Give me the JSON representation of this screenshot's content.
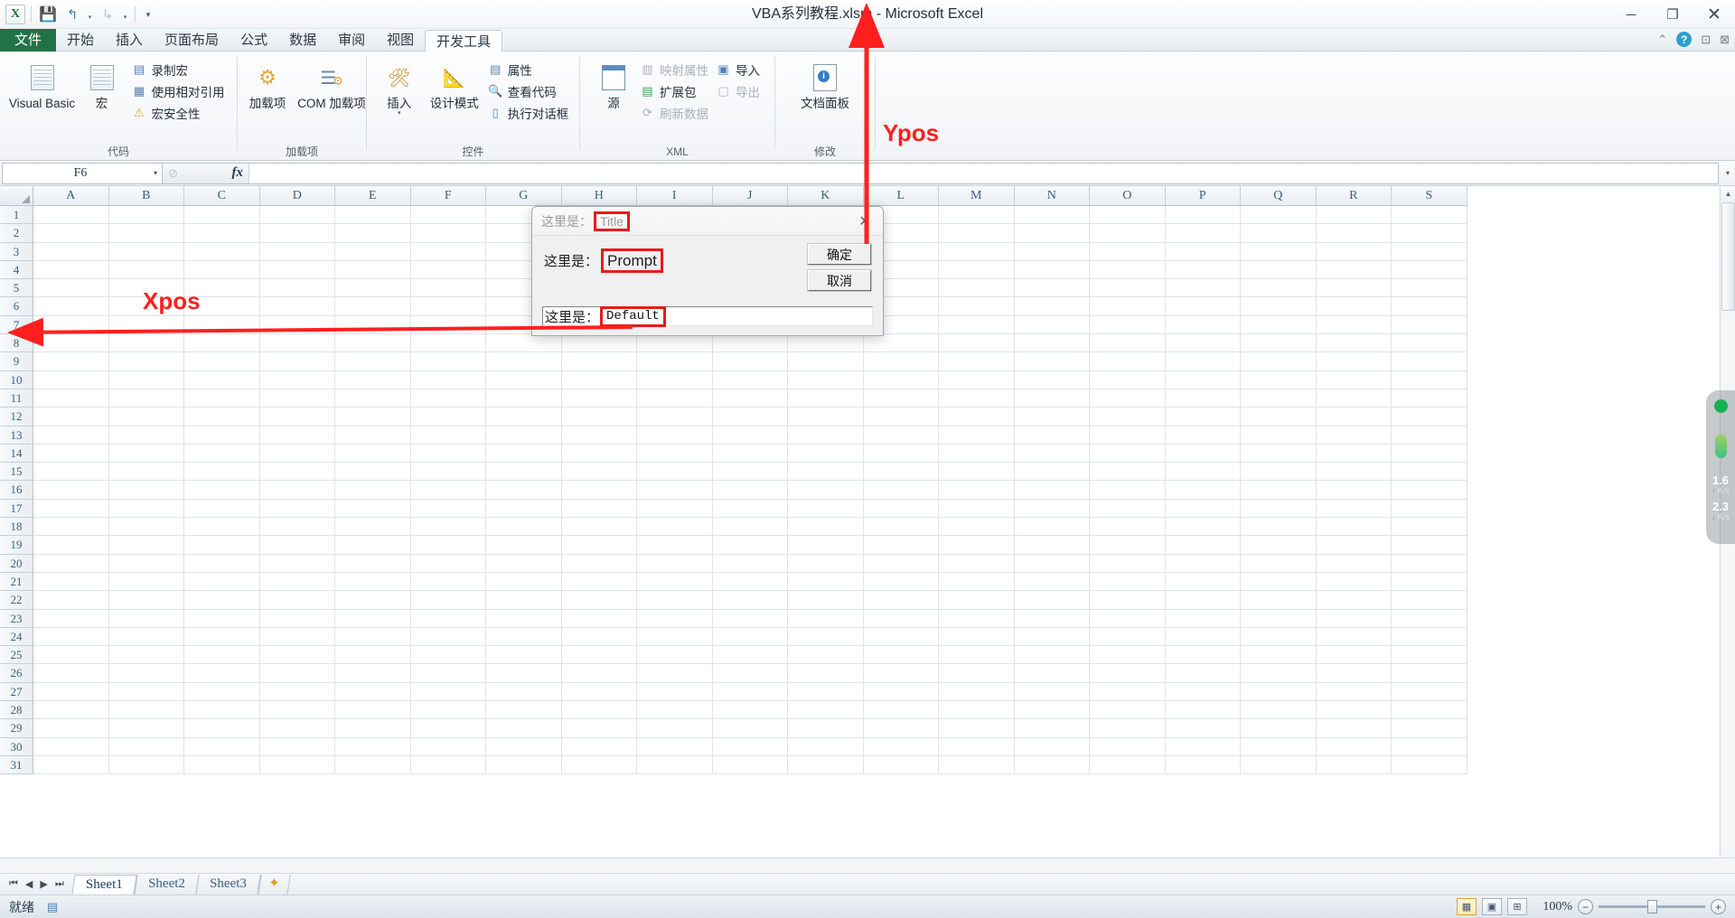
{
  "window": {
    "title": "VBA系列教程.xlsm - Microsoft Excel",
    "minimize": "─",
    "maximize": "❐",
    "close": "✕"
  },
  "quick_access": {
    "logo": "X",
    "save": "💾",
    "undo": "↰",
    "redo": "↳",
    "caret": "▾",
    "more": "▾"
  },
  "help_icons": {
    "collapse_ribbon": "⌃",
    "help": "?",
    "restore_window": "⊡",
    "close_window": "⊠"
  },
  "tabs": [
    {
      "label": "文件",
      "kind": "file"
    },
    {
      "label": "开始",
      "kind": "normal"
    },
    {
      "label": "插入",
      "kind": "normal"
    },
    {
      "label": "页面布局",
      "kind": "normal"
    },
    {
      "label": "公式",
      "kind": "normal"
    },
    {
      "label": "数据",
      "kind": "normal"
    },
    {
      "label": "审阅",
      "kind": "normal"
    },
    {
      "label": "视图",
      "kind": "normal"
    },
    {
      "label": "开发工具",
      "kind": "active"
    }
  ],
  "ribbon": {
    "groups": [
      {
        "label": "代码",
        "big": [
          {
            "label": "Visual Basic",
            "icon": "vba-icon"
          },
          {
            "label": "宏",
            "icon": "macro-icon"
          }
        ],
        "small": [
          {
            "label": "录制宏",
            "icon": "record-macro-icon",
            "dim": false
          },
          {
            "label": "使用相对引用",
            "icon": "relative-reference-icon",
            "dim": false
          },
          {
            "label": "宏安全性",
            "icon": "macro-security-icon",
            "dim": false
          }
        ]
      },
      {
        "label": "加载项",
        "big": [
          {
            "label": "加载项",
            "icon": "addins-icon"
          },
          {
            "label": "COM 加载项",
            "icon": "com-addins-icon"
          }
        ],
        "small": []
      },
      {
        "label": "控件",
        "big": [
          {
            "label": "插入",
            "icon": "insert-control-icon",
            "dropdown": "▾"
          },
          {
            "label": "设计模式",
            "icon": "design-mode-icon"
          }
        ],
        "small": [
          {
            "label": "属性",
            "icon": "properties-icon",
            "dim": false
          },
          {
            "label": "查看代码",
            "icon": "view-code-icon",
            "dim": false
          },
          {
            "label": "执行对话框",
            "icon": "run-dialog-icon",
            "dim": false
          }
        ]
      },
      {
        "label": "XML",
        "big": [
          {
            "label": "源",
            "icon": "xml-source-icon"
          }
        ],
        "small": [
          {
            "label": "映射属性",
            "icon": "map-properties-icon",
            "dim": true
          },
          {
            "label": "扩展包",
            "icon": "expansion-pack-icon",
            "dim": false
          },
          {
            "label": "刷新数据",
            "icon": "refresh-data-icon",
            "dim": true
          }
        ],
        "small2": [
          {
            "label": "导入",
            "icon": "import-icon",
            "dim": false
          },
          {
            "label": "导出",
            "icon": "export-icon",
            "dim": true
          }
        ]
      },
      {
        "label": "修改",
        "big": [
          {
            "label": "文档面板",
            "icon": "document-panel-icon"
          }
        ],
        "small": []
      }
    ]
  },
  "formula_bar": {
    "name_box": "F6",
    "name_box_caret": "▾",
    "cancel_icon": "⊘",
    "fx_symbol": "fx",
    "formula_value": "",
    "expand_caret": "▾"
  },
  "grid": {
    "columns": [
      "A",
      "B",
      "C",
      "D",
      "E",
      "F",
      "G",
      "H",
      "I",
      "J",
      "K",
      "L",
      "M",
      "N",
      "O",
      "P",
      "Q",
      "R",
      "S"
    ],
    "rows": [
      1,
      2,
      3,
      4,
      5,
      6,
      7,
      8,
      9,
      10,
      11,
      12,
      13,
      14,
      15,
      16,
      17,
      18,
      19,
      20,
      21,
      22,
      23,
      24,
      25,
      26,
      27,
      28,
      29,
      30,
      31
    ]
  },
  "dialog": {
    "title_prefix": "这里是：",
    "title_value": "Title",
    "close_icon": "✕",
    "prompt_prefix": "这里是：",
    "prompt_value": "Prompt",
    "ok_button": "确定",
    "cancel_button": "取消",
    "default_prefix": "这里是：",
    "default_value": "Default"
  },
  "annotations": {
    "xpos": "Xpos",
    "ypos": "Ypos",
    "arrow_color": "#ff1f1f"
  },
  "scrollbars": {
    "v_up": "▲",
    "v_down": "▼",
    "h_left": "◀",
    "h_right": "▶"
  },
  "sheet_tabs": {
    "nav": [
      "⏮",
      "◀",
      "▶",
      "⏭"
    ],
    "tabs": [
      {
        "label": "Sheet1",
        "active": true
      },
      {
        "label": "Sheet2",
        "active": false
      },
      {
        "label": "Sheet3",
        "active": false
      }
    ],
    "new_sheet_icon": "new-sheet-icon"
  },
  "status_bar": {
    "state": "就绪",
    "macro_icon": "record-macro-status-icon",
    "views": [
      {
        "name": "normal-view",
        "glyph": "▦",
        "selected": true
      },
      {
        "name": "page-layout-view",
        "glyph": "▣",
        "selected": false
      },
      {
        "name": "page-break-view",
        "glyph": "⊞",
        "selected": false
      }
    ],
    "zoom": "100%",
    "zoom_out": "−",
    "zoom_in": "+"
  },
  "net_widget": {
    "upload_value": "1.6",
    "upload_unit": "K/s",
    "download_value": "2.3",
    "download_unit": "K/s",
    "up_arrow": "↑",
    "down_arrow": "↓"
  }
}
